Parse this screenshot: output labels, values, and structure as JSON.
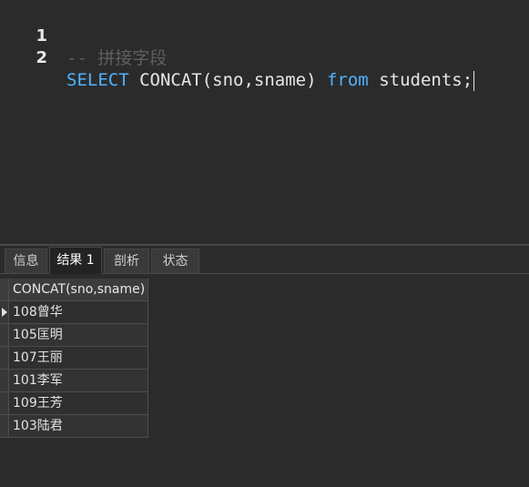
{
  "editor": {
    "lines": [
      {
        "number": "1",
        "comment": "-- 拼接字段"
      },
      {
        "number": "2",
        "kw1": "SELECT",
        "mid": " CONCAT(sno,sname) ",
        "kw2": "from",
        "tail": " students;"
      }
    ]
  },
  "tabs": [
    {
      "label": "信息",
      "active": false
    },
    {
      "label": "结果 1",
      "active": true
    },
    {
      "label": "剖析",
      "active": false
    },
    {
      "label": "状态",
      "active": false
    }
  ],
  "results": {
    "column_header": "CONCAT(sno,sname)",
    "rows": [
      "108曾华",
      "105匡明",
      "107王丽",
      "101李军",
      "109王芳",
      "103陆君"
    ],
    "selected_row_index": 0
  },
  "colors": {
    "background": "#2b2b2b",
    "keyword": "#4fb3ff",
    "comment": "#5f5f5f",
    "text": "#e6e6e6"
  }
}
